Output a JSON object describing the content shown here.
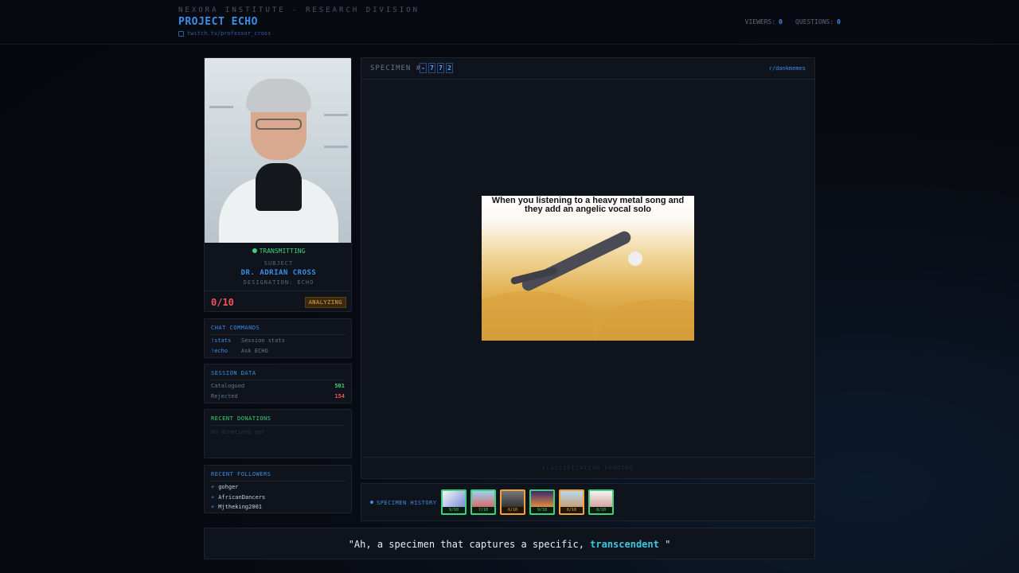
{
  "header": {
    "org": "NEXORA INSTITUTE - RESEARCH DIVISION",
    "project": "PROJECT ECHO",
    "channel": "twitch.tv/professor_cross",
    "viewers_label": "VIEWERS:",
    "viewers": "0",
    "questions_label": "QUESTIONS:",
    "questions": "0"
  },
  "subject": {
    "status": "TRANSMITTING",
    "label": "SUBJECT",
    "name": "DR. ADRIAN CROSS",
    "designation": "DESIGNATION: ECHO",
    "score": "0/10",
    "badge": "ANALYZING"
  },
  "commands": {
    "title": "CHAT COMMANDS",
    "items": [
      {
        "cmd": "!stats",
        "desc": "Session stats"
      },
      {
        "cmd": "!echo",
        "desc": "Ask ECHO"
      }
    ]
  },
  "session": {
    "title": "SESSION DATA",
    "catalogued_label": "Catalogued",
    "catalogued": "501",
    "rejected_label": "Rejected",
    "rejected": "154"
  },
  "donations": {
    "title": "RECENT DONATIONS",
    "empty": "No donations yet"
  },
  "followers": {
    "title": "RECENT FOLLOWERS",
    "items": [
      "gohger",
      "AfricanDancers",
      "Mjtheking2001"
    ]
  },
  "specimen": {
    "label": "SPECIMEN #",
    "digits": [
      "-",
      "7",
      "7",
      "2"
    ],
    "subreddit": "r/dankmemes",
    "meme_text": "When you listening to a heavy metal song and they add an angelic vocal solo",
    "classification": "CLASSIFICATION PENDING"
  },
  "history": {
    "label": "SPECIMEN HISTORY",
    "items": [
      {
        "score": "9/10",
        "tier": "high"
      },
      {
        "score": "7/10",
        "tier": "high"
      },
      {
        "score": "6/10",
        "tier": "mid"
      },
      {
        "score": "9/10",
        "tier": "high"
      },
      {
        "score": "6/10",
        "tier": "mid"
      },
      {
        "score": "8/10",
        "tier": "high"
      }
    ]
  },
  "quote": {
    "before": "\"Ah, a specimen that captures a specific, ",
    "highlight": "transcendent",
    "after": " \""
  },
  "colors": {
    "accent": "#3b8eea",
    "good": "#3fd17a",
    "warn": "#f0a33a",
    "bad": "#f0545c"
  }
}
